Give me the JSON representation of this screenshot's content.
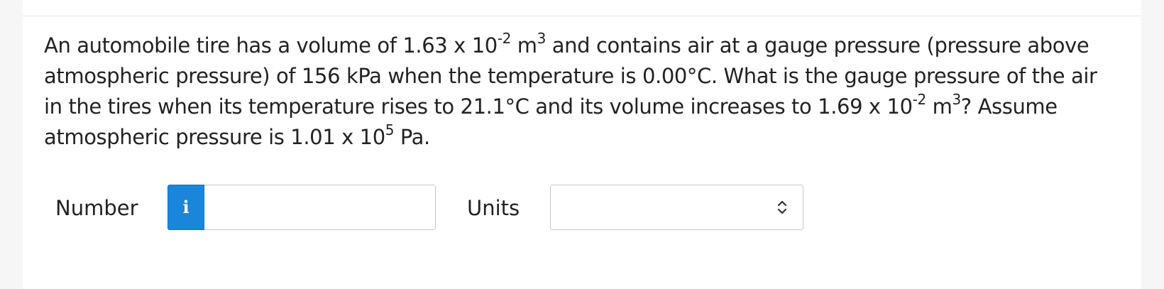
{
  "question": {
    "line1_a": "An automobile tire has a volume of 1.63 x 10",
    "line1_exp1": "-2",
    "line1_b": " m",
    "line1_exp2": "3",
    "line1_c": " and contains air at a gauge pressure (pressure above atmospheric pressure) of 156 kPa when the temperature is 0.00°C. What is the gauge pressure of the air in the tires when its temperature rises to 21.1°C and its volume increases to 1.69 x 10",
    "line3_exp1": "-2",
    "line3_b": " m",
    "line3_exp2": "3",
    "line3_c": "? Assume atmospheric pressure is 1.01 x 10",
    "line4_exp": "5",
    "line4_d": " Pa."
  },
  "answer": {
    "number_label": "Number",
    "info_symbol": "i",
    "number_value": "",
    "number_placeholder": "",
    "units_label": "Units",
    "units_selected": ""
  },
  "icons": {
    "info": "info-icon",
    "select_arrows": "chevron-up-down-icon"
  },
  "colors": {
    "info_button": "#1a86db",
    "text": "#222222",
    "page_background": "#f6f6f6"
  }
}
